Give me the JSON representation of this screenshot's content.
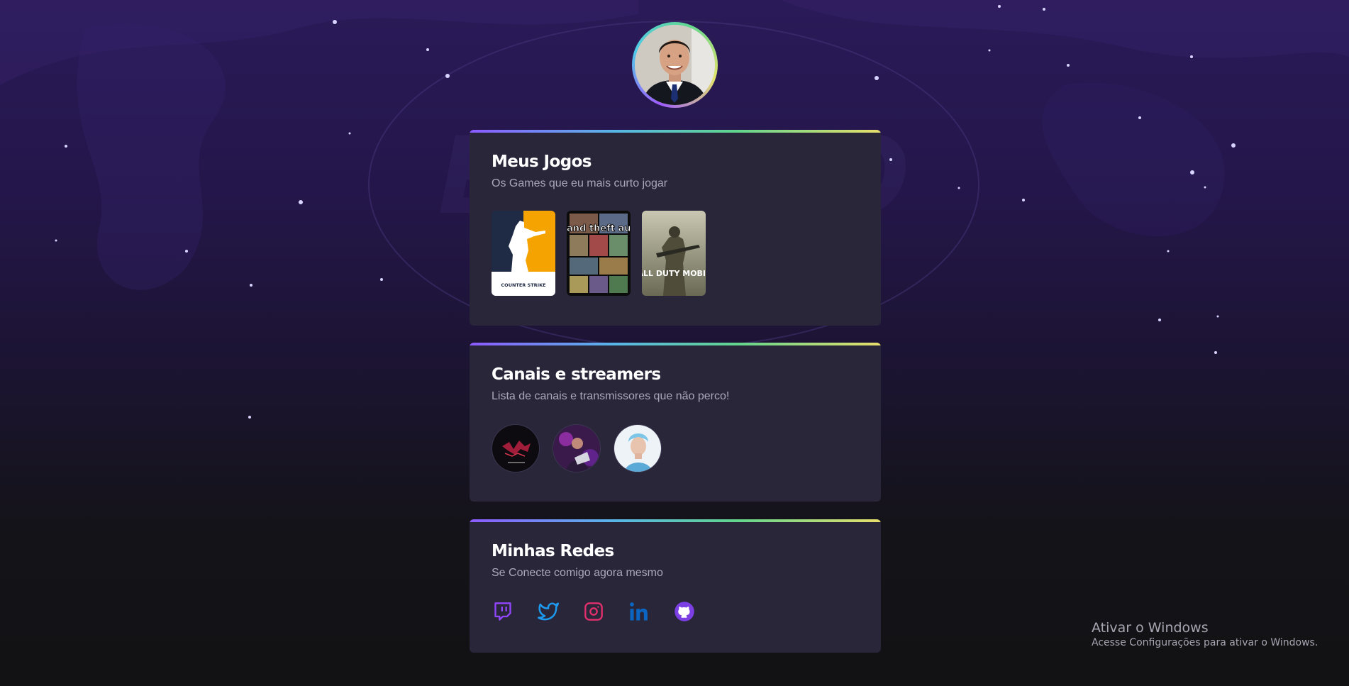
{
  "profile": {
    "avatar_icon": "profile-photo"
  },
  "games": {
    "title": "Meus Jogos",
    "subtitle": "Os Games que eu mais curto jogar",
    "items": [
      {
        "name": "Counter Strike",
        "cover_label": "COUNTER STRIKE"
      },
      {
        "name": "Grand Theft Auto San Andreas",
        "cover_label": "grand theft auto"
      },
      {
        "name": "Call of Duty Mobile",
        "cover_label": "CALL DUTY MOBILE"
      }
    ]
  },
  "channels": {
    "title": "Canais e streamers",
    "subtitle": "Lista de canais e transmissores que não perco!"
  },
  "social": {
    "title": "Minhas Redes",
    "subtitle": "Se Conecte comigo agora mesmo",
    "links": [
      {
        "network": "twitch",
        "color": "#9146ff"
      },
      {
        "network": "twitter",
        "color": "#1d9bf0"
      },
      {
        "network": "instagram",
        "color": "#e1306c"
      },
      {
        "network": "linkedin",
        "color": "#0a66c2"
      },
      {
        "network": "github",
        "color": "#7b3fe4"
      }
    ]
  },
  "windows_watermark": {
    "title": "Ativar o Windows",
    "subtitle": "Acesse Configurações para ativar o Windows."
  },
  "colors": {
    "card_bg": "#29263a",
    "gradient": [
      "#8c5bff",
      "#58b5e8",
      "#62d58d",
      "#e8df6c"
    ]
  }
}
